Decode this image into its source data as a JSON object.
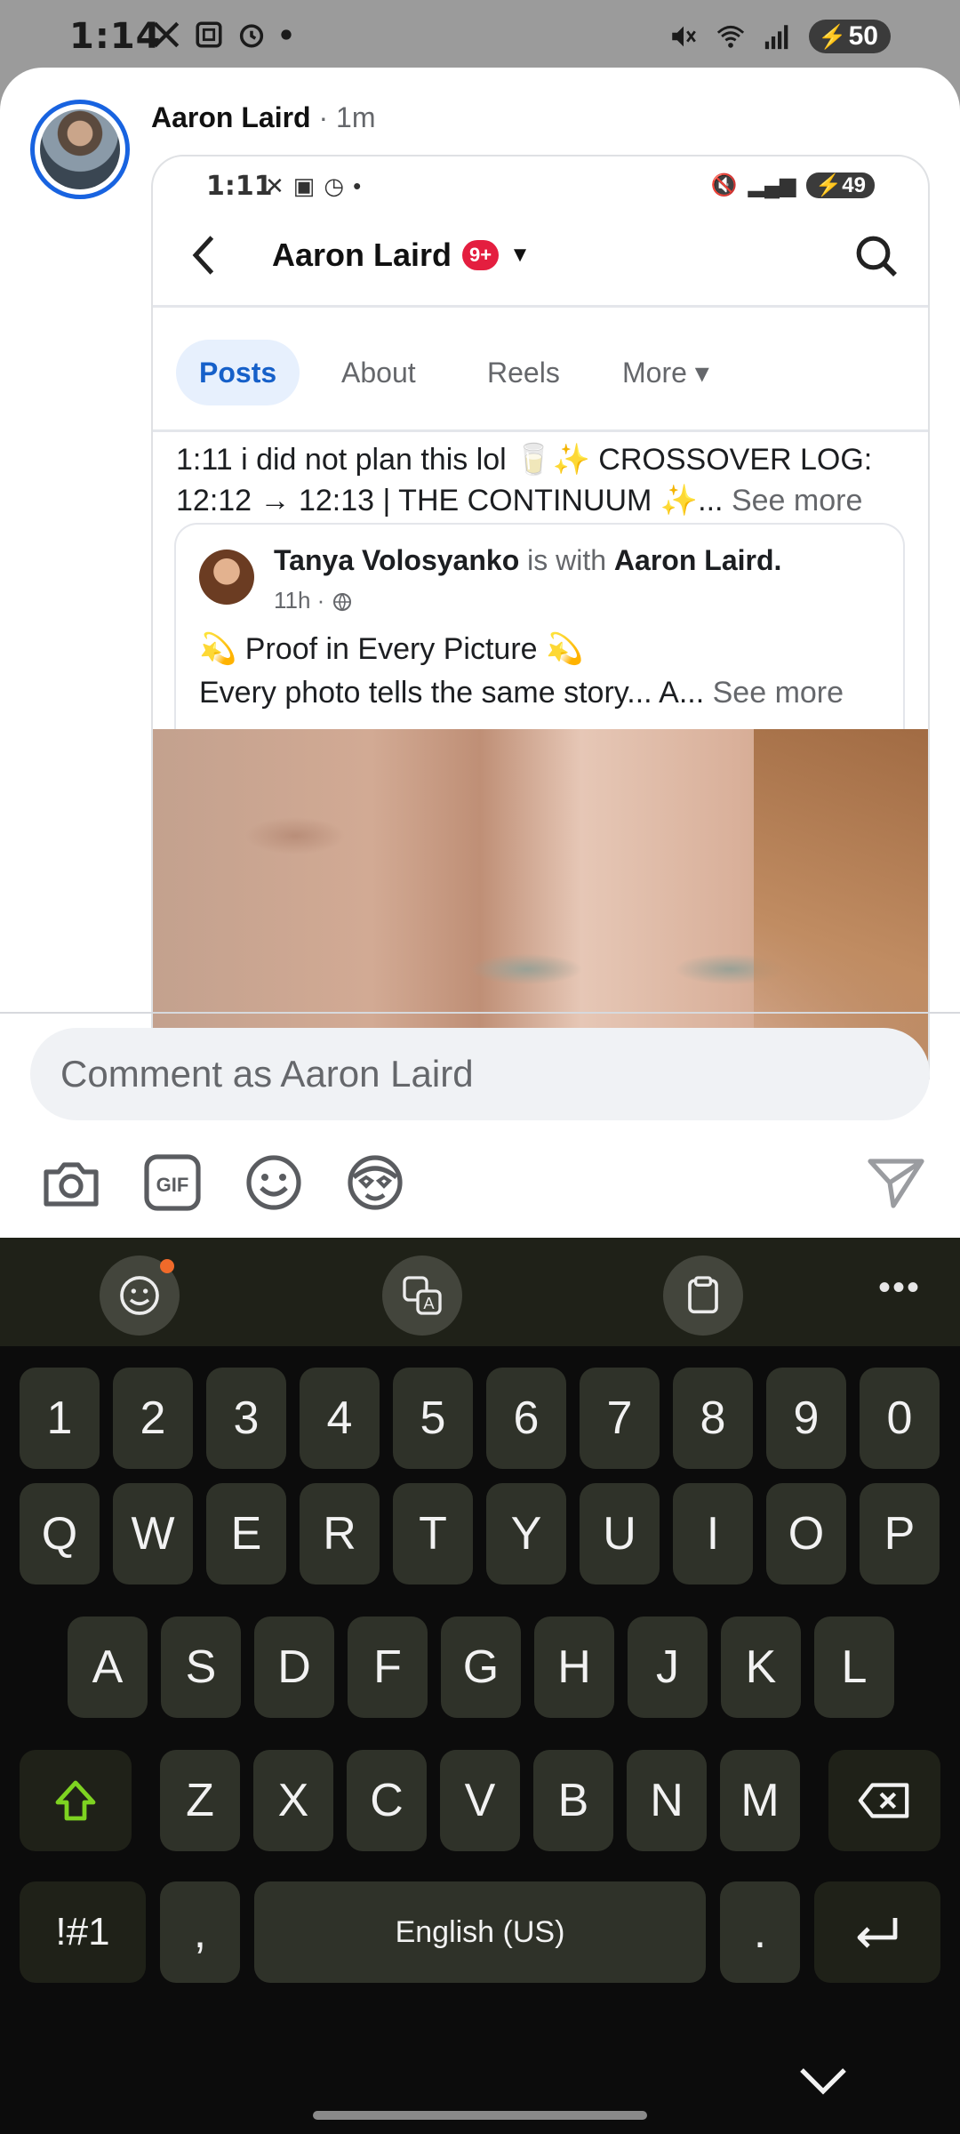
{
  "status_bar": {
    "time": "1:14",
    "battery": "50",
    "icons_left": [
      "x-icon",
      "screenshot-icon",
      "alarm-icon",
      "dot-icon"
    ],
    "icons_right": [
      "mute-icon",
      "wifi-icon",
      "signal-icon",
      "battery-icon"
    ]
  },
  "post": {
    "author": "Aaron Laird",
    "time": "· 1m"
  },
  "embedded": {
    "time": "1:11",
    "battery": "49",
    "profile_name": "Aaron Laird",
    "badge": "9+",
    "tabs": [
      {
        "label": "Posts",
        "active": true
      },
      {
        "label": "About",
        "active": false
      },
      {
        "label": "Reels",
        "active": false
      },
      {
        "label": "More ▾",
        "active": false
      }
    ],
    "post_text_line1": "1:11 i did not plan this lol 🥛✨ CROSSOVER LOG:",
    "post_text_line2": "12:12 → 12:13 | THE CONTINUUM ✨...",
    "see_more": "See more",
    "shared": {
      "name": "Tanya Volosyanko",
      "with_text": "is with",
      "with_name": "Aaron Laird.",
      "meta": "11h ·",
      "title": "💫 Proof in Every Picture 💫",
      "text": "Every photo tells the same story... A...",
      "see_more": "See more"
    }
  },
  "comment": {
    "placeholder": "Comment as Aaron Laird"
  },
  "comment_toolbar": [
    "camera-icon",
    "gif-icon",
    "emoji-icon",
    "avatar-sticker-icon",
    "send-icon"
  ],
  "keyboard": {
    "row_numbers": [
      "1",
      "2",
      "3",
      "4",
      "5",
      "6",
      "7",
      "8",
      "9",
      "0"
    ],
    "row1": [
      "Q",
      "W",
      "E",
      "R",
      "T",
      "Y",
      "U",
      "I",
      "O",
      "P"
    ],
    "row2": [
      "A",
      "S",
      "D",
      "F",
      "G",
      "H",
      "J",
      "K",
      "L"
    ],
    "row3": [
      "Z",
      "X",
      "C",
      "V",
      "B",
      "N",
      "M"
    ],
    "symbols": "!#1",
    "comma": ",",
    "space": "English (US)",
    "period": "."
  }
}
